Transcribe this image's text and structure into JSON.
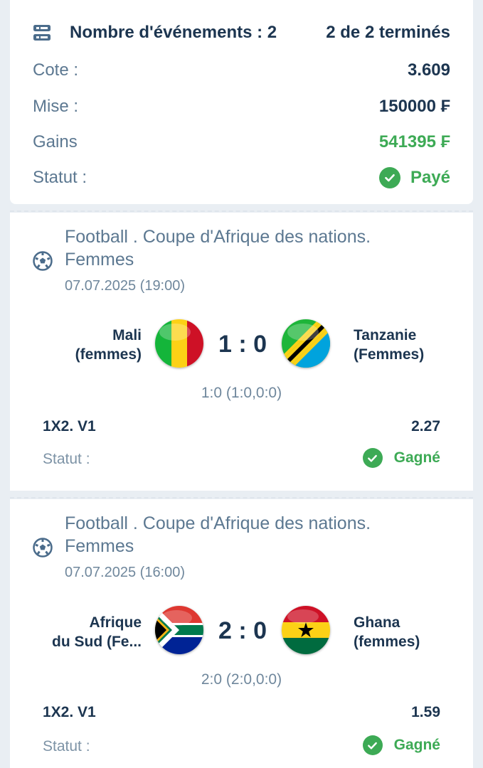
{
  "summary": {
    "events_label": "Nombre d'événements : 2",
    "finished": "2 de 2 terminés",
    "cote_label": "Cote :",
    "cote_value": "3.609",
    "mise_label": "Mise :",
    "mise_value": "150000 ₣",
    "gains_label": "Gains",
    "gains_value": "541395 ₣",
    "statut_label": "Statut :",
    "statut_value": "Payé"
  },
  "events": [
    {
      "league_line1": "Football . Coupe d'Afrique des nations.",
      "league_line2": "Femmes",
      "date": "07.07.2025 (19:00)",
      "home_line1": "Mali",
      "home_line2": "(femmes)",
      "away_line1": "Tanzanie",
      "away_line2": "(Femmes)",
      "score": "1 : 0",
      "subscore": "1:0 (1:0,0:0)",
      "market": "1X2. V1",
      "odd": "2.27",
      "status_label": "Statut :",
      "status_value": "Gagné"
    },
    {
      "league_line1": "Football . Coupe d'Afrique des nations.",
      "league_line2": "Femmes",
      "date": "07.07.2025 (16:00)",
      "home_line1": "Afrique",
      "home_line2": "du Sud (Fe...",
      "away_line1": "Ghana",
      "away_line2": "(femmes)",
      "score": "2 : 0",
      "subscore": "2:0 (2:0,0:0)",
      "market": "1X2. V1",
      "odd": "1.59",
      "status_label": "Statut :",
      "status_value": "Gagné"
    }
  ],
  "icons": {
    "events": "list-icon",
    "sport": "soccer-ball-icon",
    "status": "check-circle-icon"
  },
  "colors": {
    "accent_green": "#3daa55",
    "text_dark": "#1c3550",
    "text_muted": "#5c7891",
    "background": "#e9eef3"
  }
}
